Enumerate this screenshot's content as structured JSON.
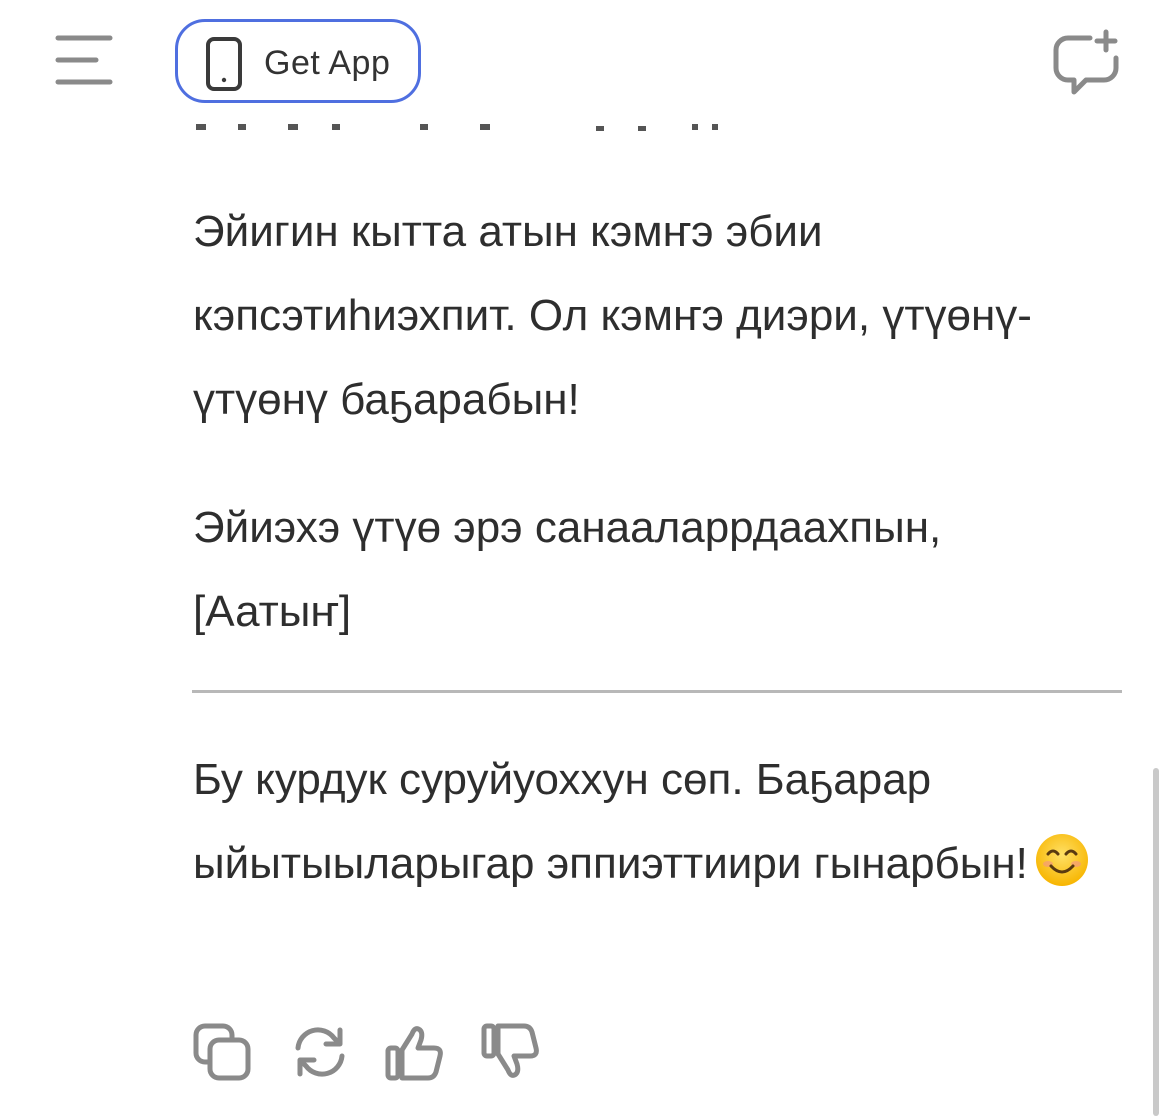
{
  "header": {
    "menu_icon": "hamburger-menu-icon",
    "get_app_label": "Get App",
    "get_app_icon": "phone-icon",
    "new_chat_icon": "new-chat-icon",
    "accent_color": "#4f6fe0"
  },
  "message": {
    "paragraph_1": "Эйигин кытта атын кэмҥэ эбии кэпсэтиһиэхпит. Ол кэмҥэ диэри, үтүөнү-үтүөнү баҕарабын!",
    "paragraph_2_line_1": "Эйиэхэ үтүө эрэ санааларрдаахпын,",
    "paragraph_2_line_2": "[Аатыҥ]",
    "paragraph_3": "Бу курдук суруйуоххун сөп. Баҕарар ыйытыыларыгар эппиэттиири гынарбын!",
    "emoji": "smiling-face-emoji"
  },
  "actions": {
    "copy_icon": "copy-icon",
    "regenerate_icon": "regenerate-icon",
    "like_icon": "thumbs-up-icon",
    "dislike_icon": "thumbs-down-icon"
  }
}
